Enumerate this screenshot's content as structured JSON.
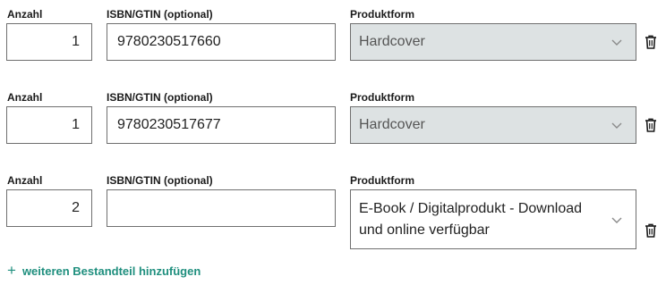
{
  "labels": {
    "quantity": "Anzahl",
    "isbn": "ISBN/GTIN (optional)",
    "format": "Produktform"
  },
  "rows": [
    {
      "quantity": "1",
      "isbn": "9780230517660",
      "format": "Hardcover",
      "format_disabled": true
    },
    {
      "quantity": "1",
      "isbn": "9780230517677",
      "format": "Hardcover",
      "format_disabled": true
    },
    {
      "quantity": "2",
      "isbn": "",
      "format_line1": "E-Book / Digitalprodukt - Download",
      "format_line2": "und online verfügbar",
      "format_disabled": false
    }
  ],
  "add_component": {
    "icon": "+",
    "label": "weiteren Bestandteil hinzufügen"
  },
  "colors": {
    "accent": "#1f8f7e",
    "disabled_select_bg": "#dde2e3",
    "border": "#6f6f6f"
  },
  "icons": {
    "dropdown": "chevron-down-icon",
    "delete": "trash-icon"
  }
}
